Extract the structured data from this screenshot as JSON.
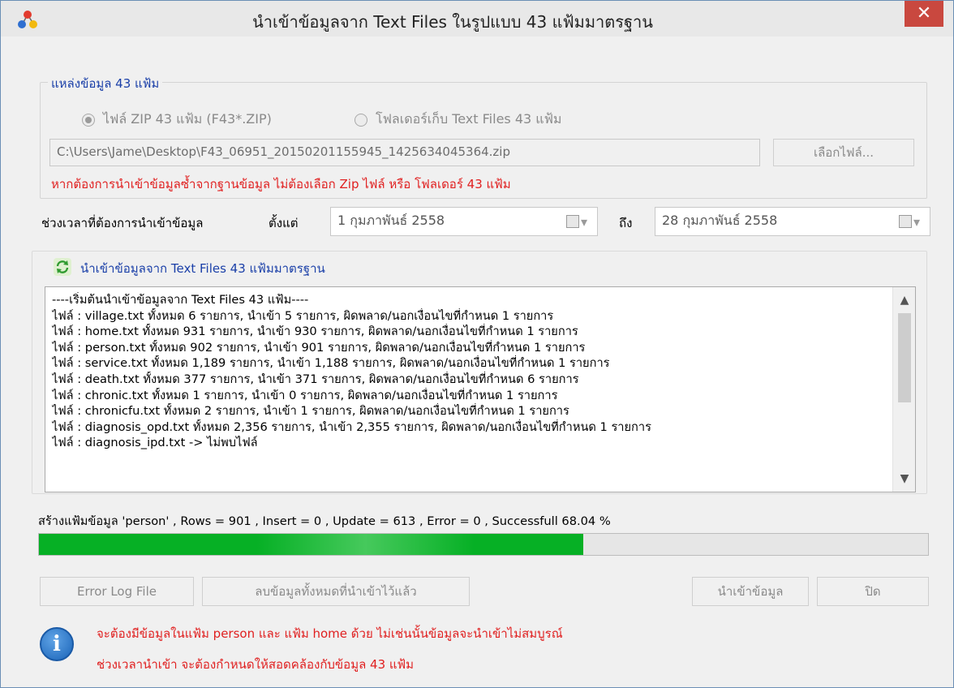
{
  "window": {
    "title": "นำเข้าข้อมูลจาก Text Files ในรูปแบบ 43 แฟ้มมาตรฐาน",
    "close_glyph": "✕",
    "accent_close": "#c9483f"
  },
  "source": {
    "group_title": "แหล่งข้อมูล 43 แฟ้ม",
    "radio_zip": "ไฟล์ ZIP 43 แฟ้ม (F43*.ZIP)",
    "radio_zip_checked": true,
    "radio_folder": "โฟลเดอร์เก็บ Text Files 43 แฟ้ม",
    "radio_folder_checked": false,
    "path_value": "C:\\Users\\Jame\\Desktop\\F43_06951_20150201155945_1425634045364.zip",
    "browse_button": "เลือกไฟล์...",
    "warning": "หากต้องการนำเข้าข้อมูลซ้ำจากฐานข้อมูล ไม่ต้องเลือก Zip ไฟล์ หรือ โฟลเดอร์ 43 แฟ้ม"
  },
  "period": {
    "label": "ช่วงเวลาที่ต้องการนำเข้าข้อมูล",
    "from_label": "ตั้งแต่",
    "from_value": "1 กุมภาพันธ์   2558",
    "to_label": "ถึง",
    "to_value": "28 กุมภาพันธ์   2558"
  },
  "import_log": {
    "group_title": "นำเข้าข้อมูลจาก Text Files 43 แฟ้มมาตรฐาน",
    "lines": [
      "----เริ่มต้นนำเข้าข้อมูลจาก Text Files 43 แฟ้ม----",
      "ไฟล์ : village.txt ทั้งหมด 6 รายการ, นำเข้า 5 รายการ, ผิดพลาด/นอกเงื่อนไขที่กำหนด 1 รายการ",
      "ไฟล์ : home.txt ทั้งหมด 931 รายการ, นำเข้า 930 รายการ, ผิดพลาด/นอกเงื่อนไขที่กำหนด 1 รายการ",
      "ไฟล์ : person.txt ทั้งหมด 902 รายการ, นำเข้า 901 รายการ, ผิดพลาด/นอกเงื่อนไขที่กำหนด 1 รายการ",
      "ไฟล์ : service.txt ทั้งหมด 1,189 รายการ, นำเข้า 1,188 รายการ, ผิดพลาด/นอกเงื่อนไขที่กำหนด 1 รายการ",
      "ไฟล์ : death.txt ทั้งหมด 377 รายการ, นำเข้า 371 รายการ, ผิดพลาด/นอกเงื่อนไขที่กำหนด 6 รายการ",
      "ไฟล์ : chronic.txt ทั้งหมด 1 รายการ, นำเข้า 0 รายการ, ผิดพลาด/นอกเงื่อนไขที่กำหนด 1 รายการ",
      "ไฟล์ : chronicfu.txt ทั้งหมด 2 รายการ, นำเข้า 1 รายการ, ผิดพลาด/นอกเงื่อนไขที่กำหนด 1 รายการ",
      "ไฟล์ : diagnosis_opd.txt ทั้งหมด 2,356 รายการ, นำเข้า 2,355 รายการ, ผิดพลาด/นอกเงื่อนไขที่กำหนด 1 รายการ",
      "ไฟล์ : diagnosis_ipd.txt -> ไม่พบไฟล์"
    ]
  },
  "status": {
    "text": "สร้างแฟ้มข้อมูล 'person' , Rows = 901 , Insert = 0 , Update = 613 , Error = 0 , Successfull 68.04 %",
    "progress_fraction": 0.6121,
    "progress_color": "#06b025"
  },
  "buttons": {
    "error_log": "Error Log File",
    "delete_all": "ลบข้อมูลทั้งหมดที่นำเข้าไว้แล้ว",
    "import": "นำเข้าข้อมูล",
    "close": "ปิด"
  },
  "notice": {
    "icon_glyph": "i",
    "line1": "จะต้องมีข้อมูลในแฟ้ม person และ แฟ้ม home ด้วย ไม่เช่นนั้นข้อมูลจะนำเข้าไม่สมบูรณ์",
    "line2": "ช่วงเวลานำเข้า จะต้องกำหนดให้สอดคล้องกับข้อมูล 43 แฟ้ม"
  }
}
